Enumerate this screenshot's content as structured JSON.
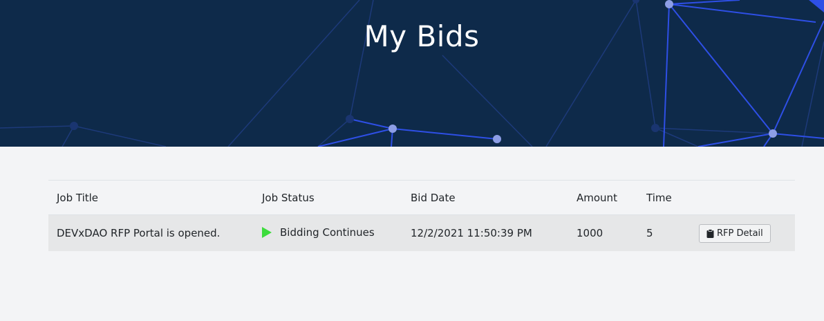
{
  "header": {
    "title": "My Bids"
  },
  "table": {
    "columns": [
      "Job Title",
      "Job Status",
      "Bid Date",
      "Amount",
      "Time",
      ""
    ],
    "rows": [
      {
        "job_title": "DEVxDAO RFP Portal is opened.",
        "status_icon": "play-icon",
        "job_status": "Bidding Continues",
        "bid_date": "12/2/2021 11:50:39 PM",
        "amount": "1000",
        "time": "5",
        "action_icon": "clipboard-icon",
        "action_label": "RFP Detail"
      }
    ]
  },
  "colors": {
    "header_bg": "#0e2a4a",
    "network_lines": "#2b4bd6",
    "status_green": "#3ddc3d",
    "row_bg": "#e6e7e8",
    "page_bg": "#f3f4f6"
  }
}
